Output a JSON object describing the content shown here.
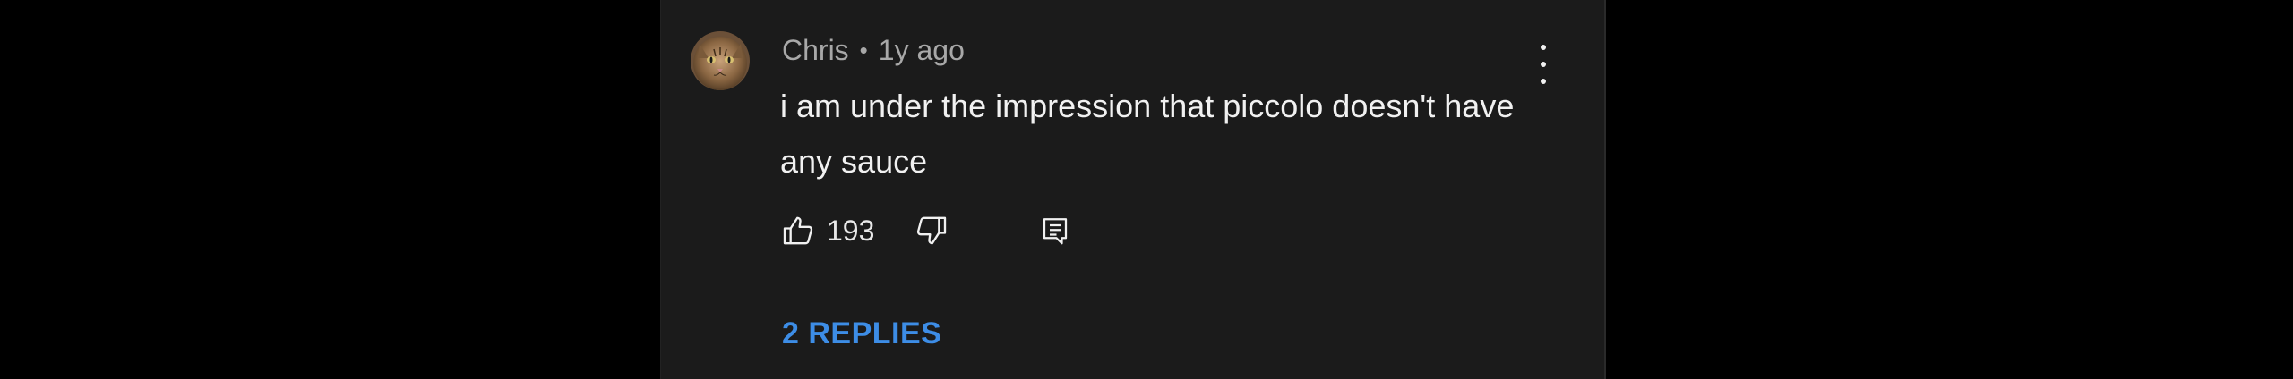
{
  "comment": {
    "author": "Chris",
    "separator": "•",
    "timestamp": "1y ago",
    "text": "i am under the impression that piccolo doesn't have any sauce",
    "like_count": "193",
    "replies_label": "2 REPLIES"
  },
  "icons": {
    "avatar": "cat-avatar",
    "menu": "more-vertical-icon",
    "like": "thumbs-up-icon",
    "dislike": "thumbs-down-icon",
    "reply": "reply-comment-icon"
  },
  "colors": {
    "background": "#000000",
    "card": "#1b1b1b",
    "author": "#a8a8a8",
    "text": "#f1f1f1",
    "replies": "#3d8de6"
  }
}
